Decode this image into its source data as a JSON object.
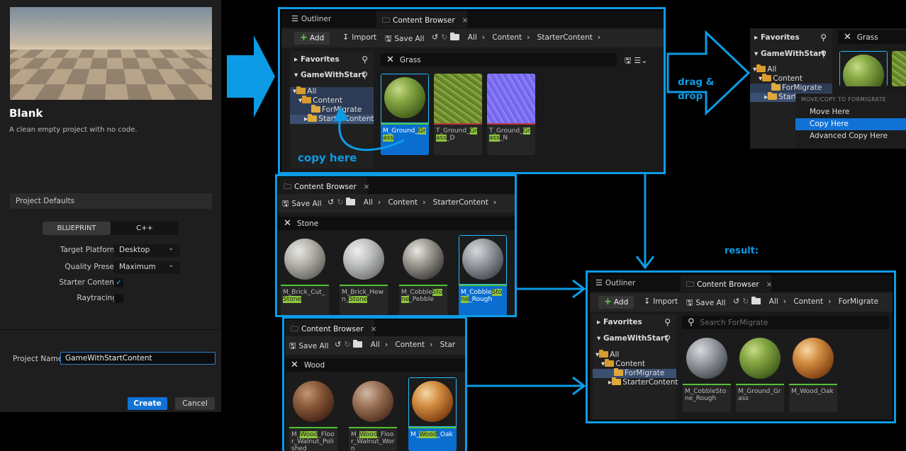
{
  "project": {
    "title": "Blank",
    "description": "A clean empty project with no code.",
    "defaults_header": "Project Defaults",
    "template_options": [
      "BLUEPRINT",
      "C++"
    ],
    "target_platform": {
      "label": "Target Platform",
      "value": "Desktop"
    },
    "quality_preset": {
      "label": "Quality Preset",
      "value": "Maximum"
    },
    "starter_content": {
      "label": "Starter Content",
      "checked": true
    },
    "raytracing": {
      "label": "Raytracing",
      "checked": false
    },
    "name_label": "Project Name",
    "name_value": "GameWithStartContent",
    "create_label": "Create",
    "cancel_label": "Cancel"
  },
  "browser_main": {
    "tab_outliner": "Outliner",
    "tab_content": "Content Browser",
    "add": "Add",
    "import": "Import",
    "save_all": "Save All",
    "crumbs": [
      "All",
      "Content",
      "StarterContent"
    ],
    "favorites": "Favorites",
    "root": "GameWithStart",
    "tree": [
      "All",
      "Content",
      "ForMigrate",
      "StarterContent"
    ],
    "search": "Grass",
    "assets": [
      {
        "pre": "M_Ground_",
        "hl": "Grass",
        "post": ""
      },
      {
        "pre": "T_Ground_",
        "hl": "Grass",
        "post": "_D"
      },
      {
        "pre": "T_Ground_",
        "hl": "Grass",
        "post": "_N"
      }
    ]
  },
  "annotations": {
    "copy_here": "copy here",
    "drag_drop": "drag &\ndrop",
    "result": "result:"
  },
  "context_panel": {
    "favorites": "Favorites",
    "root": "GameWithStart",
    "search": "Grass",
    "tree": [
      "All",
      "Content",
      "ForMigrate",
      "Starter"
    ],
    "menu_header": "MOVE/COPY TO FORMIGRATE",
    "items": [
      "Move Here",
      "Copy Here",
      "Advanced Copy Here"
    ]
  },
  "stone_browser": {
    "tab": "Content Browser",
    "save_all": "Save All",
    "crumbs": [
      "All",
      "Content",
      "StarterContent"
    ],
    "search": "Stone",
    "assets": [
      {
        "pre": "M_Brick_Cut_",
        "hl": "Stone",
        "post": ""
      },
      {
        "pre": "M_Brick_Hewn_",
        "hl": "Stone",
        "post": ""
      },
      {
        "pre": "M_Cobble",
        "hl": "Stone",
        "post": "_Pebble"
      },
      {
        "pre": "M_Cobble",
        "hl": "Stone",
        "post": "_Rough"
      }
    ]
  },
  "wood_browser": {
    "tab": "Content Browser",
    "save_all": "Save All",
    "crumbs": [
      "All",
      "Content",
      "Star"
    ],
    "search": "Wood",
    "assets": [
      {
        "pre": "M_",
        "hl": "Wood",
        "post": "_Floor_Walnut_Polished"
      },
      {
        "pre": "M_",
        "hl": "Wood",
        "post": "_Floor_Walnut_Worn"
      },
      {
        "pre": "M_",
        "hl": "Wood",
        "post": "_Oak"
      }
    ]
  },
  "result_browser": {
    "tab_outliner": "Outliner",
    "tab_content": "Content Browser",
    "add": "Add",
    "import": "Import",
    "save_all": "Save All",
    "crumbs": [
      "All",
      "Content",
      "ForMigrate"
    ],
    "favorites": "Favorites",
    "root": "GameWithStart",
    "tree": [
      "All",
      "Content",
      "ForMigrate",
      "StarterContent"
    ],
    "search_placeholder": "Search ForMigrate",
    "assets": [
      "M_CobbleStone_Rough",
      "M_Ground_Grass",
      "M_Wood_Oak"
    ]
  },
  "colors": {
    "accent": "#0d9be5",
    "material_bar": "#52c234",
    "texture_bar": "#c0343f",
    "selection": "#0a6ed1"
  }
}
